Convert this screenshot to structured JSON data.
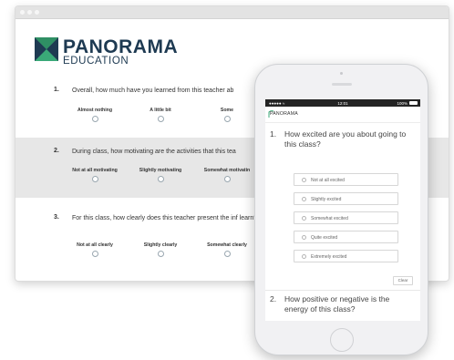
{
  "brand": {
    "name": "PANORAMA",
    "sub": "EDUCATION",
    "color": "#1e3a52",
    "mark_dark": "#1e3a52",
    "mark_green": "#3aa978"
  },
  "desktop_survey": {
    "questions": [
      {
        "number": "1.",
        "text": "Overall, how much have you learned from this teacher ab",
        "options": [
          "Almost nothing",
          "A little bit",
          "Some"
        ]
      },
      {
        "number": "2.",
        "text": "During class, how motivating are the activities that this tea",
        "options": [
          "Not at all motivating",
          "Slightly motivating",
          "Somewhat motivatin"
        ]
      },
      {
        "number": "3.",
        "text": "For this class, how clearly does this teacher present the inf learn?",
        "options": [
          "Not at all clearly",
          "Slightly clearly",
          "Somewhat clearly"
        ]
      }
    ]
  },
  "phone": {
    "status": {
      "signal": "●●●●● ≈",
      "time": "12:01",
      "battery": "100%"
    },
    "header_logo": "PANORAMA",
    "question1": {
      "number": "1.",
      "text": "How excited are you about going to this class?"
    },
    "choices": [
      "Not at all excited",
      "Slightly excited",
      "Somewhat excited",
      "Quite excited",
      "Extremely excited"
    ],
    "clear_label": "Clear",
    "question2": {
      "number": "2.",
      "text": "How positive or negative is the energy of this class?"
    }
  }
}
